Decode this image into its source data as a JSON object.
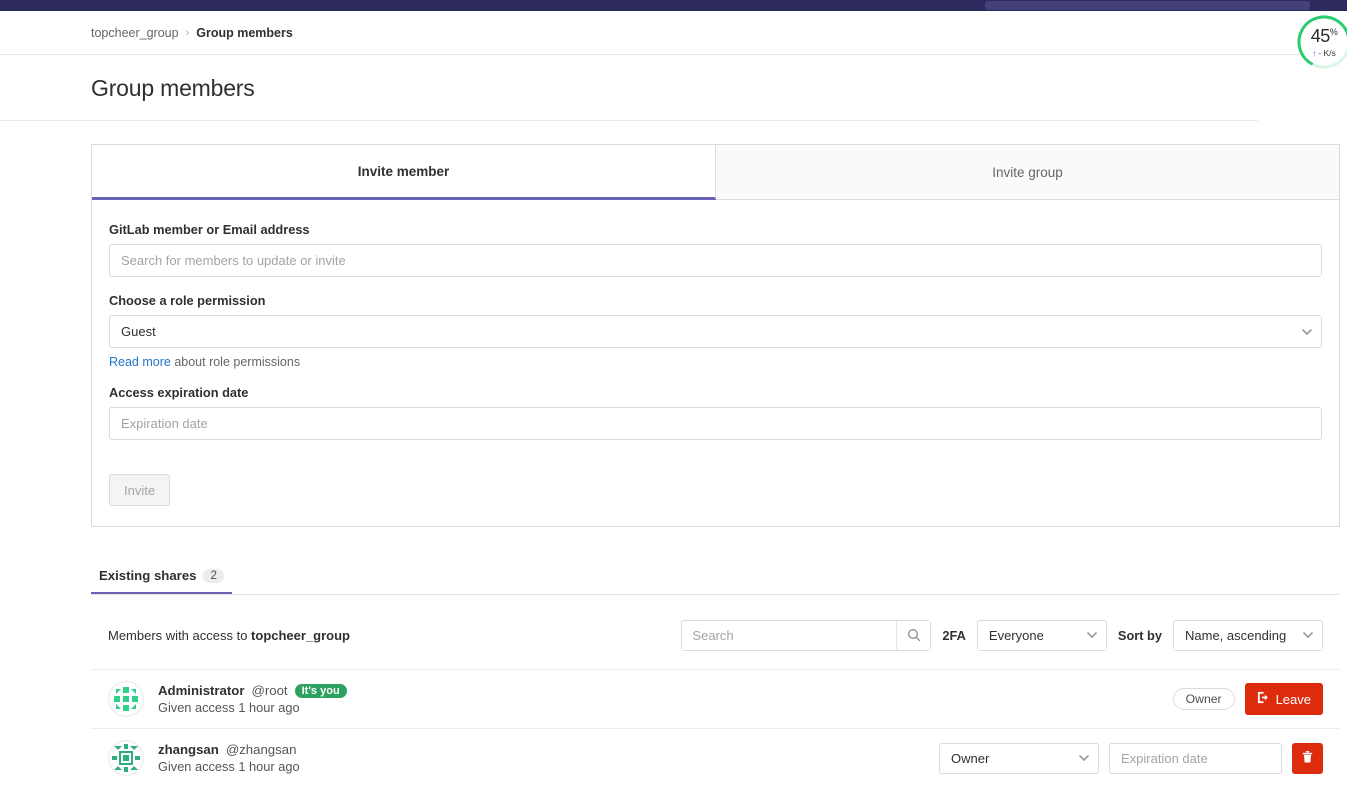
{
  "topbar": {
    "search_placeholder": ""
  },
  "breadcrumb": {
    "group": "topcheer_group",
    "separator": "›",
    "current": "Group members"
  },
  "page_title": "Group members",
  "invite_card": {
    "tabs": [
      {
        "label": "Invite member",
        "active": true
      },
      {
        "label": "Invite group",
        "active": false
      }
    ],
    "member_field": {
      "label": "GitLab member or Email address",
      "placeholder": "Search for members to update or invite",
      "value": ""
    },
    "role_field": {
      "label": "Choose a role permission",
      "value": "Guest"
    },
    "helper": {
      "link_text": "Read more",
      "rest_text": " about role permissions"
    },
    "expiration_field": {
      "label": "Access expiration date",
      "placeholder": "Expiration date",
      "value": ""
    },
    "invite_button": "Invite"
  },
  "existing_shares": {
    "tab_label": "Existing shares",
    "count": "2",
    "access_prefix": "Members with access to ",
    "access_group": "topcheer_group",
    "search_placeholder": "Search",
    "search_value": "",
    "twofa_label": "2FA",
    "twofa_value": "Everyone",
    "sort_label": "Sort by",
    "sort_value": "Name, ascending",
    "members": [
      {
        "name": "Administrator",
        "handle": "@root",
        "badge": "It's you",
        "access_text": "Given access 1 hour ago",
        "role_pill": "Owner",
        "action_label": "Leave"
      },
      {
        "name": "zhangsan",
        "handle": "@zhangsan",
        "badge": "",
        "access_text": "Given access 1 hour ago",
        "role_value": "Owner",
        "expiration_placeholder": "Expiration date",
        "expiration_value": ""
      }
    ]
  },
  "speed_gauge": {
    "percent": "45",
    "percent_symbol": "%",
    "rate": "- K/s",
    "arrow": "↑"
  },
  "colors": {
    "topbar": "#2d2a5e",
    "tab_accent": "#6b63b5",
    "link": "#1f75cb",
    "danger": "#dd2b0e",
    "success": "#2da160",
    "gauge": "#2ecc71"
  }
}
